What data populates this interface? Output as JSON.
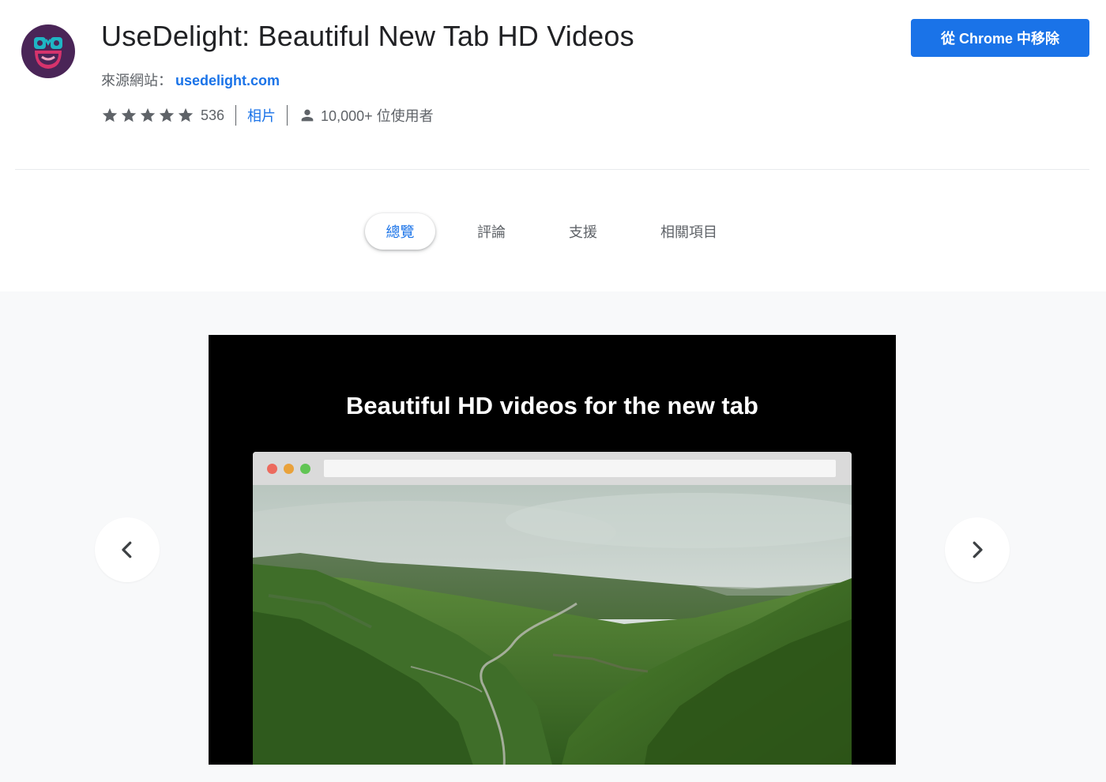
{
  "header": {
    "title": "UseDelight: Beautiful New Tab HD Videos",
    "source_label": "來源網站：",
    "source_link": "usedelight.com",
    "rating": 5,
    "rating_count": "536",
    "photos_link": "相片",
    "users": "10,000+ 位使用者",
    "remove_button": "從 Chrome 中移除"
  },
  "tabs": [
    {
      "label": "總覽",
      "active": true
    },
    {
      "label": "評論",
      "active": false
    },
    {
      "label": "支援",
      "active": false
    },
    {
      "label": "相關項目",
      "active": false
    }
  ],
  "gallery": {
    "slide_heading": "Beautiful HD videos for the new tab",
    "prev_icon": "chevron-left-icon",
    "next_icon": "chevron-right-icon"
  },
  "colors": {
    "accent": "#1a73e8",
    "logo_background": "#4a2557",
    "logo_face": "#d6336c",
    "logo_eyes": "#1fb5c4",
    "text_secondary": "#5f6368"
  }
}
